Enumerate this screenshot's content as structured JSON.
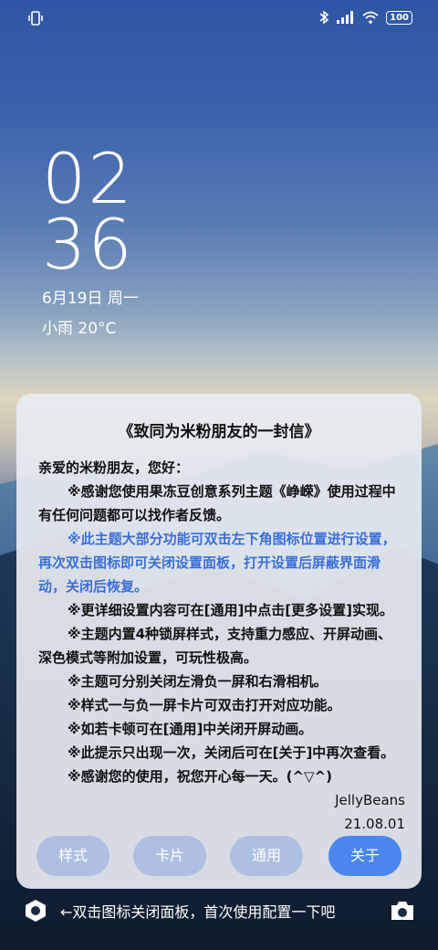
{
  "status": {
    "battery": "100"
  },
  "clock": {
    "hour": "02",
    "minute": "36",
    "date": "6月19日 周一",
    "weather": "小雨 20°C"
  },
  "panel": {
    "title": "《致同为米粉朋友的一封信》",
    "greeting": "亲爱的米粉朋友，您好：",
    "p1": "※感谢您使用果冻豆创意系列主题《峥嵘》使用过程中有任何问题都可以找作者反馈。",
    "p2": "※此主题大部分功能可双击左下角图标位置进行设置，再次双击图标即可关闭设置面板，打开设置后屏蔽界面滑动，关闭后恢复。",
    "p3": "※更详细设置内容可在[通用]中点击[更多设置]实现。",
    "p4": "※主题内置4种锁屏样式，支持重力感应、开屏动画、深色模式等附加设置，可玩性极高。",
    "p5": "※主题可分别关闭左滑负一屏和右滑相机。",
    "p6": "※样式一与负一屏卡片可双击打开对应功能。",
    "p7": "※如若卡顿可在[通用]中关闭开屏动画。",
    "p8": "※此提示只出现一次，关闭后可在[关于]中再次查看。",
    "p9": "※感谢您的使用，祝您开心每一天。(^▽^)",
    "sign": "JellyBeans",
    "date": "21.08.01",
    "buttons": [
      "样式",
      "卡片",
      "通用",
      "关于"
    ]
  },
  "bottom": {
    "hint": "←双击图标关闭面板，首次使用配置一下吧"
  }
}
